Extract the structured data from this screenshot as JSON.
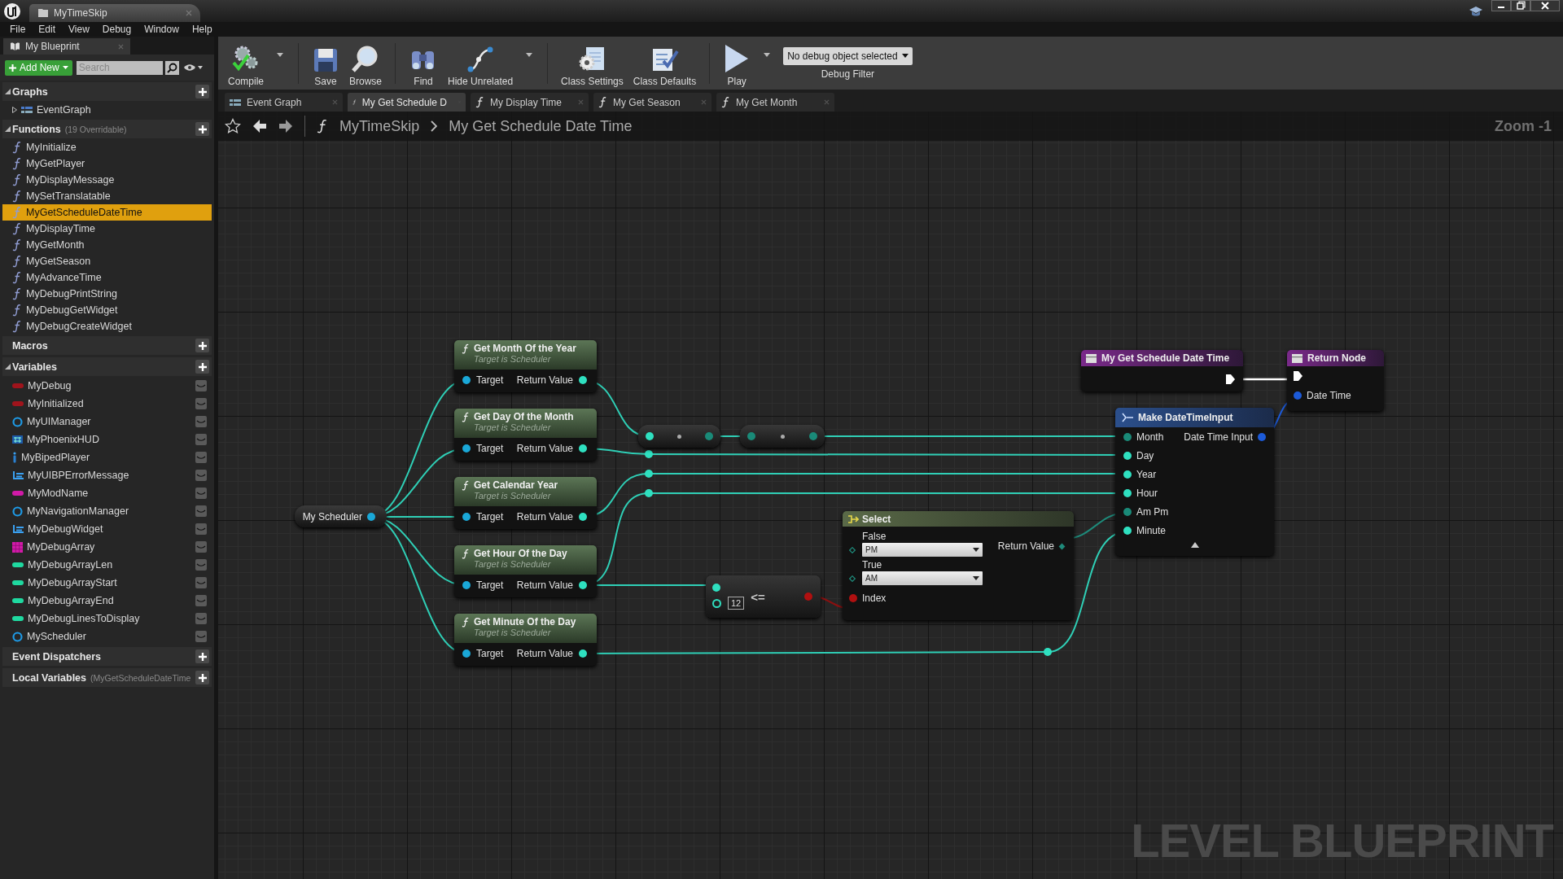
{
  "window": {
    "tab_title": "MyTimeSkip"
  },
  "menu": [
    "File",
    "Edit",
    "View",
    "Debug",
    "Window",
    "Help"
  ],
  "my_blueprint": {
    "tab_title": "My Blueprint",
    "add_new": "Add New",
    "search": {
      "placeholder": "Search"
    },
    "sections": [
      {
        "title": "Graphs",
        "items": [
          {
            "kind": "graph",
            "label": "EventGraph",
            "selected": false
          }
        ]
      },
      {
        "title": "Functions",
        "note": "(19 Overridable)",
        "items": [
          {
            "kind": "function",
            "label": "MyInitialize",
            "selected": false
          },
          {
            "kind": "function",
            "label": "MyGetPlayer",
            "selected": false
          },
          {
            "kind": "function",
            "label": "MyDisplayMessage",
            "selected": false
          },
          {
            "kind": "function",
            "label": "MySetTranslatable",
            "selected": false
          },
          {
            "kind": "function",
            "label": "MyGetScheduleDateTime",
            "selected": true
          },
          {
            "kind": "function",
            "label": "MyDisplayTime",
            "selected": false
          },
          {
            "kind": "function",
            "label": "MyGetMonth",
            "selected": false
          },
          {
            "kind": "function",
            "label": "MyGetSeason",
            "selected": false
          },
          {
            "kind": "function",
            "label": "MyAdvanceTime",
            "selected": false
          },
          {
            "kind": "function",
            "label": "MyDebugPrintString",
            "selected": false
          },
          {
            "kind": "function",
            "label": "MyDebugGetWidget",
            "selected": false
          },
          {
            "kind": "function",
            "label": "MyDebugCreateWidget",
            "selected": false
          }
        ]
      },
      {
        "title": "Macros"
      },
      {
        "title": "Variables",
        "items": [
          {
            "kind": "bool",
            "label": "MyDebug",
            "selected": false
          },
          {
            "kind": "bool",
            "label": "MyInitialized",
            "selected": false
          },
          {
            "kind": "object",
            "label": "MyUIManager",
            "selected": false
          },
          {
            "kind": "hud",
            "label": "MyPhoenixHUD",
            "selected": false
          },
          {
            "kind": "person",
            "label": "MyBipedPlayer",
            "selected": false
          },
          {
            "kind": "widget",
            "label": "MyUIBPErrorMessage",
            "selected": false
          },
          {
            "kind": "name",
            "label": "MyModName",
            "selected": false
          },
          {
            "kind": "object",
            "label": "MyNavigationManager",
            "selected": false
          },
          {
            "kind": "widget",
            "label": "MyDebugWidget",
            "selected": false
          },
          {
            "kind": "array",
            "label": "MyDebugArray",
            "selected": false
          },
          {
            "kind": "int",
            "label": "MyDebugArrayLen",
            "selected": false
          },
          {
            "kind": "int",
            "label": "MyDebugArrayStart",
            "selected": false
          },
          {
            "kind": "int",
            "label": "MyDebugArrayEnd",
            "selected": false
          },
          {
            "kind": "int",
            "label": "MyDebugLinesToDisplay",
            "selected": false
          },
          {
            "kind": "object",
            "label": "MyScheduler",
            "selected": false
          }
        ]
      },
      {
        "title": "Event Dispatchers"
      },
      {
        "title": "Local Variables",
        "note": "(MyGetScheduleDateTime"
      }
    ]
  },
  "toolbar": {
    "groups": [
      [
        {
          "kind": "compile",
          "label": "Compile",
          "menu": true
        }
      ],
      [
        {
          "kind": "save",
          "label": "Save"
        },
        {
          "kind": "browse",
          "label": "Browse"
        }
      ],
      [
        {
          "kind": "find",
          "label": "Find"
        },
        {
          "kind": "hide",
          "label": "Hide Unrelated",
          "menu": true
        }
      ],
      [
        {
          "kind": "settings",
          "label": "Class Settings"
        },
        {
          "kind": "defaults",
          "label": "Class Defaults"
        }
      ],
      [
        {
          "kind": "play",
          "label": "Play",
          "menu": true
        }
      ]
    ],
    "debug_filter": {
      "value": "No debug object selected",
      "label": "Debug Filter"
    }
  },
  "graph_tabs": [
    {
      "kind": "graph",
      "label": "Event Graph",
      "selected": false
    },
    {
      "kind": "function",
      "label": "My Get Schedule D",
      "selected": true
    },
    {
      "kind": "function",
      "label": "My Display Time",
      "selected": false
    },
    {
      "kind": "function",
      "label": "My Get Season",
      "selected": false
    },
    {
      "kind": "function",
      "label": "My Get Month",
      "selected": false
    }
  ],
  "breadcrumb": [
    "MyTimeSkip",
    "My Get Schedule Date Time"
  ],
  "graph": {
    "zoom": "Zoom -1",
    "graph_label": "LEVEL BLUEPRINT",
    "variable_node": {
      "label": "My Scheduler"
    },
    "function_nodes": [
      {
        "title": "Get Month Of the Year",
        "subtitle": "Target is Scheduler",
        "input": "Target",
        "output": "Return Value"
      },
      {
        "title": "Get Day Of the Month",
        "subtitle": "Target is Scheduler",
        "input": "Target",
        "output": "Return Value"
      },
      {
        "title": "Get Calendar Year",
        "subtitle": "Target is Scheduler",
        "input": "Target",
        "output": "Return Value"
      },
      {
        "title": "Get Hour Of the Day",
        "subtitle": "Target is Scheduler",
        "input": "Target",
        "output": "Return Value"
      },
      {
        "title": "Get Minute Of the Day",
        "subtitle": "Target is Scheduler",
        "input": "Target",
        "output": "Return Value"
      }
    ],
    "compare_node": {
      "value": "12",
      "operator": "<="
    },
    "select_node": {
      "title": "Select",
      "options": [
        {
          "label": "False",
          "value": "PM"
        },
        {
          "label": "True",
          "value": "AM"
        }
      ],
      "output": "Return Value",
      "index": "Index"
    },
    "make_node": {
      "title": "Make DateTimeInput",
      "inputs": [
        "Month",
        "Day",
        "Year",
        "Hour",
        "Am Pm",
        "Minute"
      ],
      "output": "Date Time Input"
    },
    "entry_node": {
      "title": "My Get Schedule Date Time"
    },
    "return_node": {
      "title": "Return Node",
      "input": "Date Time"
    }
  }
}
